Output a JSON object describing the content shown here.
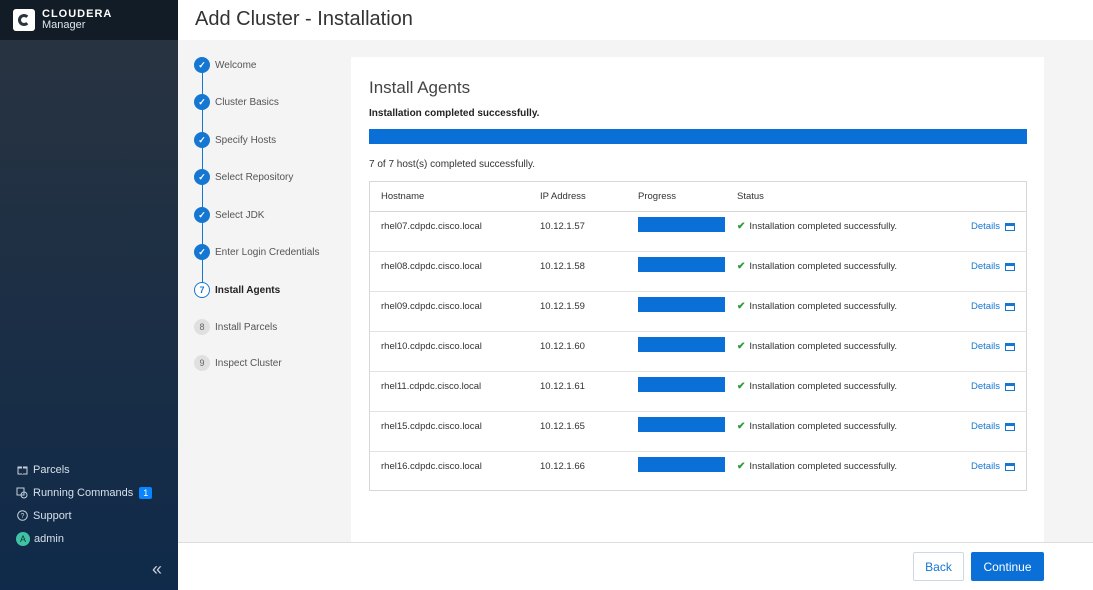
{
  "brand": {
    "line1": "CLOUDERA",
    "line2": "Manager"
  },
  "page_title": "Add Cluster - Installation",
  "nav": {
    "parcels": "Parcels",
    "running_commands": "Running Commands",
    "running_commands_badge": "1",
    "support": "Support",
    "user": "admin",
    "user_initial": "A",
    "collapse_glyph": "«"
  },
  "steps": [
    {
      "num": "✓",
      "label": "Welcome",
      "state": "done"
    },
    {
      "num": "✓",
      "label": "Cluster Basics",
      "state": "done"
    },
    {
      "num": "✓",
      "label": "Specify Hosts",
      "state": "done"
    },
    {
      "num": "✓",
      "label": "Select Repository",
      "state": "done"
    },
    {
      "num": "✓",
      "label": "Select JDK",
      "state": "done"
    },
    {
      "num": "✓",
      "label": "Enter Login Credentials",
      "state": "done"
    },
    {
      "num": "7",
      "label": "Install Agents",
      "state": "current"
    },
    {
      "num": "8",
      "label": "Install Parcels",
      "state": "todo"
    },
    {
      "num": "9",
      "label": "Inspect Cluster",
      "state": "todo"
    }
  ],
  "panel": {
    "title": "Install Agents",
    "message": "Installation completed successfully.",
    "overall_progress": 1.0,
    "count_text": "7 of 7 host(s) completed successfully."
  },
  "table": {
    "headers": {
      "hostname": "Hostname",
      "ip": "IP Address",
      "progress": "Progress",
      "status": "Status"
    },
    "rows": [
      {
        "hostname": "rhel07.cdpdc.cisco.local",
        "ip": "10.12.1.57",
        "progress": 1.0,
        "status": "Installation completed successfully.",
        "details": "Details"
      },
      {
        "hostname": "rhel08.cdpdc.cisco.local",
        "ip": "10.12.1.58",
        "progress": 1.0,
        "status": "Installation completed successfully.",
        "details": "Details"
      },
      {
        "hostname": "rhel09.cdpdc.cisco.local",
        "ip": "10.12.1.59",
        "progress": 1.0,
        "status": "Installation completed successfully.",
        "details": "Details"
      },
      {
        "hostname": "rhel10.cdpdc.cisco.local",
        "ip": "10.12.1.60",
        "progress": 1.0,
        "status": "Installation completed successfully.",
        "details": "Details"
      },
      {
        "hostname": "rhel11.cdpdc.cisco.local",
        "ip": "10.12.1.61",
        "progress": 1.0,
        "status": "Installation completed successfully.",
        "details": "Details"
      },
      {
        "hostname": "rhel15.cdpdc.cisco.local",
        "ip": "10.12.1.65",
        "progress": 1.0,
        "status": "Installation completed successfully.",
        "details": "Details"
      },
      {
        "hostname": "rhel16.cdpdc.cisco.local",
        "ip": "10.12.1.66",
        "progress": 1.0,
        "status": "Installation completed successfully.",
        "details": "Details"
      }
    ]
  },
  "footer": {
    "back": "Back",
    "continue": "Continue"
  },
  "colors": {
    "accent": "#0a6fd6",
    "success": "#2e9e3c",
    "nav_bg": "#1b2e45"
  }
}
